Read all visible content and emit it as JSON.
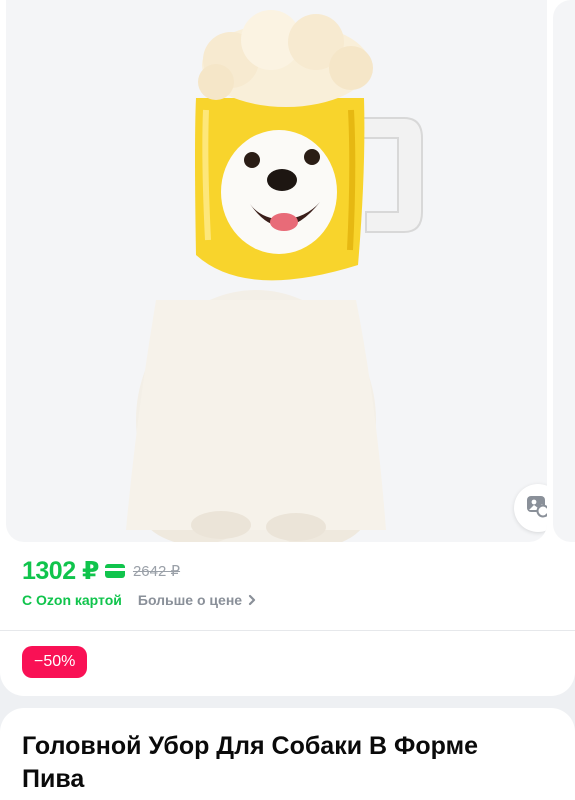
{
  "product": {
    "price": "1302 ₽",
    "old_price": "2642 ₽",
    "ozon_card_label": "С Ozon картой",
    "more_price_label": "Больше о цене",
    "discount": "−50%",
    "title": "Головной Убор Для Собаки В Форме Пива"
  },
  "icons": {
    "card": "ozon-card-icon",
    "chevron": "chevron-right-icon",
    "image_search": "image-search-icon"
  },
  "colors": {
    "price_green": "#10c44c",
    "discount_pink": "#f91155",
    "muted_gray": "#9aa0a8"
  }
}
